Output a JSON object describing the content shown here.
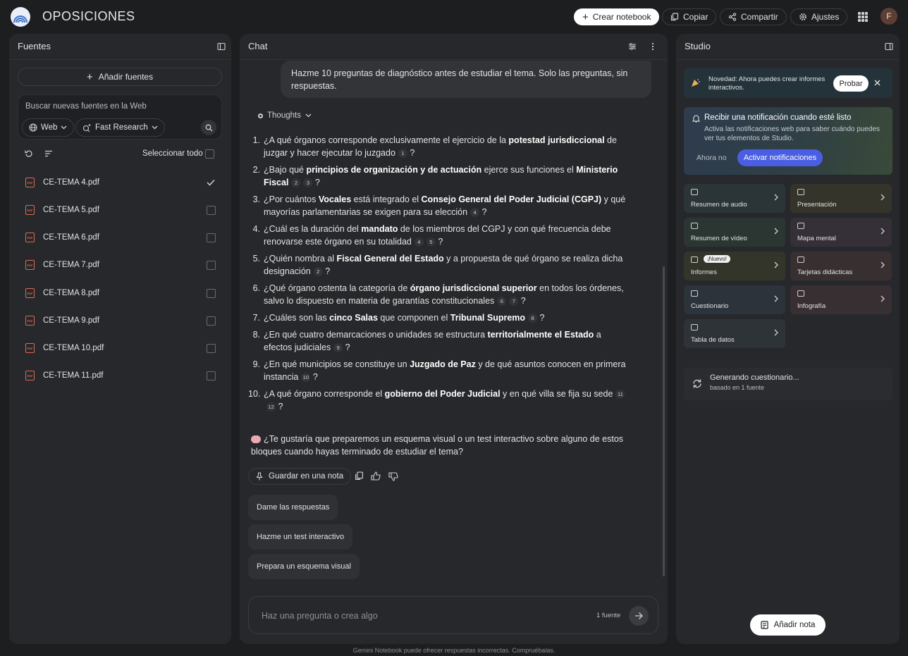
{
  "app": {
    "title": "OPOSICIONES",
    "avatar_letter": "F"
  },
  "topbar": {
    "create_notebook": "Crear notebook",
    "copy": "Copiar",
    "share": "Compartir",
    "settings": "Ajustes"
  },
  "sources": {
    "title": "Fuentes",
    "add_button": "Añadir fuentes",
    "search_placeholder": "Buscar nuevas fuentes en la Web",
    "chip_web": "Web",
    "chip_research": "Fast Research",
    "select_all": "Seleccionar todo",
    "items": [
      {
        "name": "CE-TEMA 4.pdf",
        "checked": true
      },
      {
        "name": "CE-TEMA 5.pdf",
        "checked": false
      },
      {
        "name": "CE-TEMA 6.pdf",
        "checked": false
      },
      {
        "name": "CE-TEMA 7.pdf",
        "checked": false
      },
      {
        "name": "CE-TEMA 8.pdf",
        "checked": false
      },
      {
        "name": "CE-TEMA 9.pdf",
        "checked": false
      },
      {
        "name": "CE-TEMA 10.pdf",
        "checked": false
      },
      {
        "name": "CE-TEMA 11.pdf",
        "checked": false
      }
    ]
  },
  "chat": {
    "title": "Chat",
    "user_message": "Hazme 10 preguntas de diagnóstico antes de estudiar el tema. Solo las preguntas, sin respuestas.",
    "thoughts_label": "Thoughts",
    "questions": [
      {
        "num": "1.",
        "parts": [
          [
            "¿A qué órganos corresponde exclusivamente el ejercicio de la ",
            false
          ],
          [
            "potestad jurisdiccional",
            true
          ],
          [
            " de juzgar y hacer ejecutar lo juzgado",
            false
          ]
        ],
        "cites": [
          "1"
        ]
      },
      {
        "num": "2.",
        "parts": [
          [
            "¿Bajo qué ",
            false
          ],
          [
            "principios de organización y de actuación",
            true
          ],
          [
            " ejerce sus funciones el ",
            false
          ],
          [
            "Ministerio Fiscal",
            true
          ]
        ],
        "cites": [
          "2",
          "3"
        ]
      },
      {
        "num": "3.",
        "parts": [
          [
            "¿Por cuántos ",
            false
          ],
          [
            "Vocales",
            true
          ],
          [
            " está integrado el ",
            false
          ],
          [
            "Consejo General del Poder Judicial (CGPJ)",
            true
          ],
          [
            " y qué mayorías parlamentarias se exigen para su elección",
            false
          ]
        ],
        "cites": [
          "4"
        ]
      },
      {
        "num": "4.",
        "parts": [
          [
            "¿Cuál es la duración del ",
            false
          ],
          [
            "mandato",
            true
          ],
          [
            " de los miembros del CGPJ y con qué frecuencia debe renovarse este órgano en su totalidad",
            false
          ]
        ],
        "cites": [
          "4",
          "5"
        ]
      },
      {
        "num": "5.",
        "parts": [
          [
            "¿Quién nombra al ",
            false
          ],
          [
            "Fiscal General del Estado",
            true
          ],
          [
            " y a propuesta de qué órgano se realiza dicha designación",
            false
          ]
        ],
        "cites": [
          "2"
        ]
      },
      {
        "num": "6.",
        "parts": [
          [
            "¿Qué órgano ostenta la categoría de ",
            false
          ],
          [
            "órgano jurisdiccional superior",
            true
          ],
          [
            " en todos los órdenes, salvo lo dispuesto en materia de garantías constitucionales",
            false
          ]
        ],
        "cites": [
          "6",
          "7"
        ]
      },
      {
        "num": "7.",
        "parts": [
          [
            "¿Cuáles son las ",
            false
          ],
          [
            "cinco Salas",
            true
          ],
          [
            " que componen el ",
            false
          ],
          [
            "Tribunal Supremo",
            true
          ]
        ],
        "cites": [
          "8"
        ]
      },
      {
        "num": "8.",
        "parts": [
          [
            "¿En qué cuatro demarcaciones o unidades se estructura ",
            false
          ],
          [
            "territorialmente el Estado",
            true
          ],
          [
            " a efectos judiciales",
            false
          ]
        ],
        "cites": [
          "9"
        ]
      },
      {
        "num": "9.",
        "parts": [
          [
            "¿En qué municipios se constituye un ",
            false
          ],
          [
            "Juzgado de Paz",
            true
          ],
          [
            " y de qué asuntos conocen en primera instancia",
            false
          ]
        ],
        "cites": [
          "10"
        ]
      },
      {
        "num": "10.",
        "parts": [
          [
            "¿A qué órgano corresponde el ",
            false
          ],
          [
            "gobierno del Poder Judicial",
            true
          ],
          [
            " y en qué villa se fija su sede",
            false
          ]
        ],
        "cites": [
          "11",
          "12"
        ]
      }
    ],
    "closing": "¿Te gustaría que preparemos un esquema visual o un test interactivo sobre alguno de estos bloques cuando hayas terminado de estudiar el tema?",
    "save_note": "Guardar en una nota",
    "suggestions": [
      "Dame las respuestas",
      "Hazme un test interactivo",
      "Prepara un esquema visual"
    ],
    "input_placeholder": "Haz una pregunta o crea algo",
    "source_count": "1 fuente",
    "disclaimer": "Gemini Notebook puede ofrecer respuestas incorrectas. Compruébalas."
  },
  "studio": {
    "title": "Studio",
    "banner_text": "Novedad: Ahora puedes crear informes interactivos.",
    "banner_button": "Probar",
    "notif_title": "Recibir una notificación cuando esté listo",
    "notif_desc": "Activa las notificaciones web para saber cuándo puedes ver tus elementos de Studio.",
    "notif_dismiss": "Ahora no",
    "notif_activate": "Activar notificaciones",
    "new_badge": "¡Nuevo!",
    "tiles": [
      {
        "label": "Resumen de audio",
        "color": "#2b3437"
      },
      {
        "label": "Presentación",
        "color": "#35342a"
      },
      {
        "label": "Resumen de vídeo",
        "color": "#2b3632"
      },
      {
        "label": "Mapa mental",
        "color": "#352f38"
      },
      {
        "label": "Informes",
        "color": "#33352b"
      },
      {
        "label": "Tarjetas didácticas",
        "color": "#382f31"
      },
      {
        "label": "Cuestionario",
        "color": "#2c333b"
      },
      {
        "label": "Infografía",
        "color": "#382f33"
      },
      {
        "label": "Tabla de datos",
        "color": "#2e3338"
      }
    ],
    "generating_title": "Generando cuestionario...",
    "generating_sub": "basado en 1 fuente",
    "add_note": "Añadir nota"
  }
}
